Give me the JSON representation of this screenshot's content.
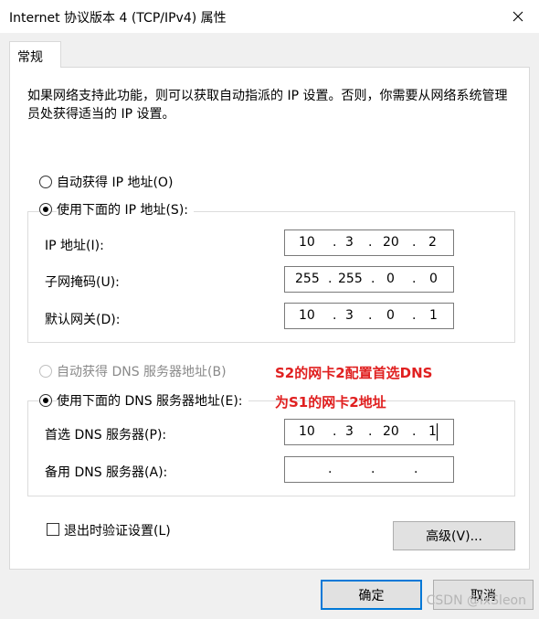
{
  "window": {
    "title": "Internet 协议版本 4 (TCP/IPv4) 属性"
  },
  "tabs": [
    {
      "label": "常规"
    }
  ],
  "description": "如果网络支持此功能，则可以获取自动指派的 IP 设置。否则，你需要从网络系统管理员处获得适当的 IP 设置。",
  "ip_section": {
    "auto_label": "自动获得 IP 地址(O)",
    "manual_label": "使用下面的 IP 地址(S):",
    "selected": "manual",
    "fields": [
      {
        "label": "IP 地址(I):",
        "octets": [
          "10",
          "3",
          "20",
          "2"
        ]
      },
      {
        "label": "子网掩码(U):",
        "octets": [
          "255",
          "255",
          "0",
          "0"
        ]
      },
      {
        "label": "默认网关(D):",
        "octets": [
          "10",
          "3",
          "0",
          "1"
        ]
      }
    ]
  },
  "dns_section": {
    "auto_label": "自动获得 DNS 服务器地址(B)",
    "manual_label": "使用下面的 DNS 服务器地址(E):",
    "selected": "manual",
    "fields": [
      {
        "label": "首选 DNS 服务器(P):",
        "octets": [
          "10",
          "3",
          "20",
          "1"
        ]
      },
      {
        "label": "备用 DNS 服务器(A):",
        "octets": [
          "",
          "",
          "",
          ""
        ]
      }
    ]
  },
  "annotation": {
    "line1": "S2的网卡2配置首选DNS",
    "line2": "为S1的网卡2地址",
    "color": "#e02020"
  },
  "validate_label": "退出时验证设置(L)",
  "advanced_label": "高级(V)...",
  "ok_label": "确定",
  "cancel_label": "取消",
  "watermark": "CSDN @lxSleon",
  "colors": {
    "focus_border": "#0078d7"
  }
}
